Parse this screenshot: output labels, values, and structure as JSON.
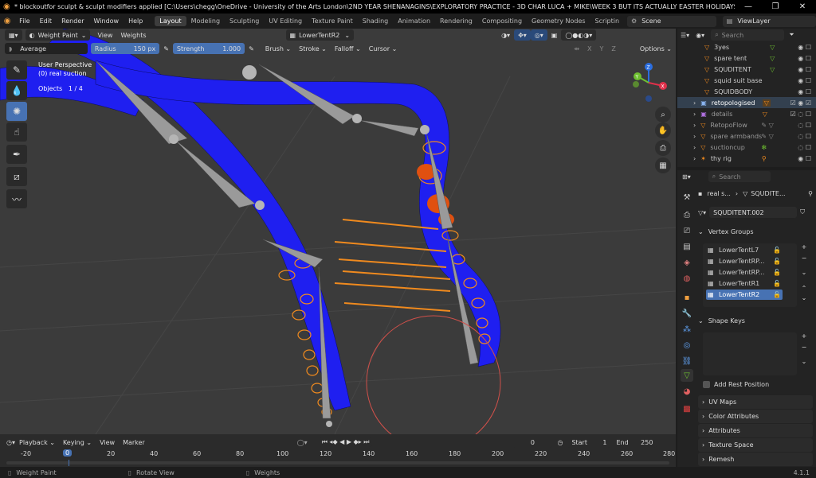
{
  "window": {
    "title": "* blockoutfor sculpt & sculpt modifiers applied [C:\\Users\\chegg\\OneDrive - University of the Arts London\\2ND YEAR SHENANAGINS\\EXPLORATORY PRACTICE - 3D CHAR LUCA + MIKE\\WEEK 3 BUT ITS ACTUALLY EASTER HOLIDAYS IM LAZY\\block...",
    "minimize": "—",
    "maximize": "❐",
    "close": "✕"
  },
  "menus": [
    "File",
    "Edit",
    "Render",
    "Window",
    "Help"
  ],
  "workspaces": [
    "Layout",
    "Modeling",
    "Sculpting",
    "UV Editing",
    "Texture Paint",
    "Shading",
    "Animation",
    "Rendering",
    "Compositing",
    "Geometry Nodes",
    "Scriptin"
  ],
  "scene": "Scene",
  "view_layer": "ViewLayer",
  "viewport_header": {
    "mode": "Weight Paint",
    "view": "View",
    "weights": "Weights",
    "active_group": "LowerTentR2",
    "brush_name": "Average",
    "radius_label": "Radius",
    "radius_value": "150 px",
    "strength_label": "Strength",
    "strength_value": "1.000",
    "brush_menu": "Brush",
    "stroke_menu": "Stroke",
    "falloff_menu": "Falloff",
    "cursor_menu": "Cursor",
    "options": "Options",
    "axis_x": "X",
    "axis_y": "Y",
    "axis_z": "Z"
  },
  "overlay": {
    "perspective": "User Perspective",
    "object": "(0) real suction",
    "objects_label": "Objects",
    "objects_value": "1 / 4"
  },
  "gizmo": {
    "z": "Z",
    "y": "Y",
    "x": "X"
  },
  "outliner": {
    "search_placeholder": "Search",
    "items": [
      {
        "name": "3yes"
      },
      {
        "name": "spare tent"
      },
      {
        "name": "SQUDITENT"
      },
      {
        "name": "squid suit base"
      },
      {
        "name": "SQUIDBODY"
      },
      {
        "name": "retopologised"
      },
      {
        "name": "details"
      },
      {
        "name": "RetopoFlow"
      },
      {
        "name": "spare armbands"
      },
      {
        "name": "suctioncup"
      },
      {
        "name": "thy rig"
      }
    ]
  },
  "properties": {
    "search_placeholder": "Search",
    "breadcrumb_object": "real s...",
    "breadcrumb_data": "SQUDITE...",
    "mesh_name": "SQUDITENT.002",
    "vertex_groups_title": "Vertex Groups",
    "vertex_groups": [
      "LowerTentL7",
      "LowerTentRP...",
      "LowerTentRP...",
      "LowerTentR1",
      "LowerTentR2"
    ],
    "shape_keys_title": "Shape Keys",
    "add_rest_position": "Add Rest Position",
    "sections": [
      "UV Maps",
      "Color Attributes",
      "Attributes",
      "Texture Space",
      "Remesh"
    ]
  },
  "timeline": {
    "playback": "Playback",
    "keying": "Keying",
    "view": "View",
    "marker": "Marker",
    "current_frame": "0",
    "start_label": "Start",
    "start_value": "1",
    "end_label": "End",
    "end_value": "250",
    "ruler": [
      "-20",
      "0",
      "20",
      "40",
      "60",
      "80",
      "100",
      "120",
      "140",
      "160",
      "180",
      "200",
      "220",
      "240",
      "260",
      "280"
    ]
  },
  "status": {
    "left": "Weight Paint",
    "middle": "Rotate View",
    "right": "Weights",
    "version": "4.1.1"
  },
  "colors": {
    "accent": "#4772b3",
    "viewport_bg": "#3b3b3b",
    "mesh_blue": "#1e1ef0",
    "suction_orange": "#f08a1e",
    "bone_grey": "#9a9a9a",
    "brush_circle": "#d0504a"
  }
}
